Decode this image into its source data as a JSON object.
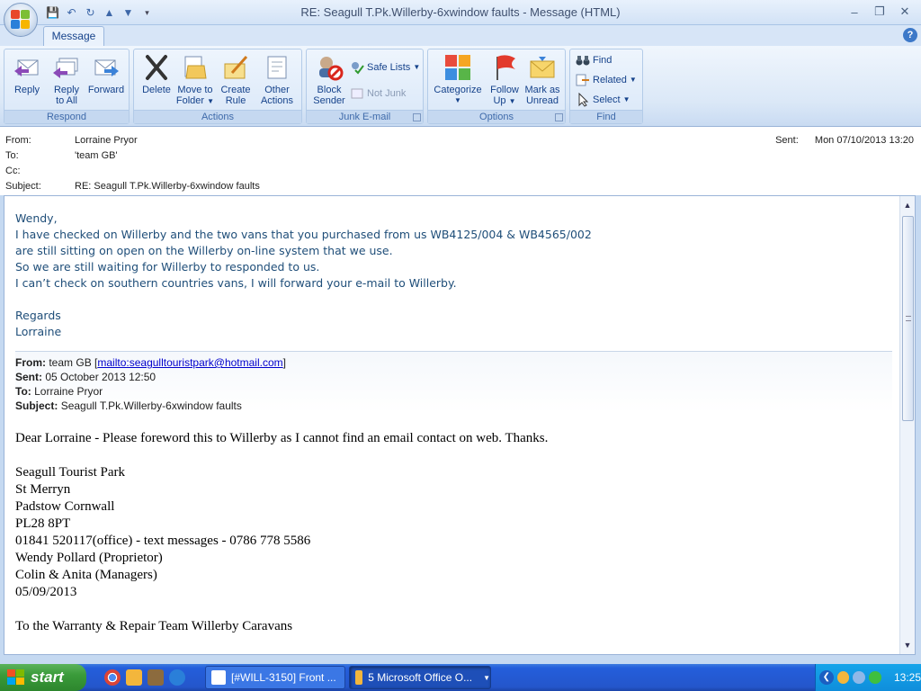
{
  "window": {
    "title": "RE: Seagull T.Pk.Willerby-6xwindow faults - Message (HTML)",
    "tab": "Message",
    "help": "?"
  },
  "ribbon": {
    "respond": {
      "label": "Respond",
      "reply": "Reply",
      "reply_all_1": "Reply",
      "reply_all_2": "to All",
      "forward": "Forward"
    },
    "actions": {
      "label": "Actions",
      "delete": "Delete",
      "move_1": "Move to",
      "move_2": "Folder",
      "create_1": "Create",
      "create_2": "Rule",
      "other_1": "Other",
      "other_2": "Actions"
    },
    "junk": {
      "label": "Junk E-mail",
      "block_1": "Block",
      "block_2": "Sender",
      "safe_lists": "Safe Lists",
      "not_junk": "Not Junk"
    },
    "options": {
      "label": "Options",
      "categorize": "Categorize",
      "follow_1": "Follow",
      "follow_2": "Up",
      "mark_1": "Mark as",
      "mark_2": "Unread"
    },
    "find": {
      "label": "Find",
      "find": "Find",
      "related": "Related",
      "select": "Select"
    }
  },
  "header": {
    "from_label": "From:",
    "from": "Lorraine Pryor",
    "to_label": "To:",
    "to": "'team GB'",
    "cc_label": "Cc:",
    "cc": "",
    "subject_label": "Subject:",
    "subject": "RE: Seagull T.Pk.Willerby-6xwindow faults",
    "sent_label": "Sent:",
    "sent": "Mon 07/10/2013 13:20"
  },
  "reply_lines": [
    "Wendy,",
    "I have checked on Willerby and the two vans that you purchased from us WB4125/004 & WB4565/002",
    "are still sitting on open on the Willerby on-line system that we use.",
    "So we are still waiting for Willerby to responded to us.",
    "I can’t check on southern countries vans, I will forward your e-mail to Willerby.",
    "",
    "Regards",
    "Lorraine"
  ],
  "quoted": {
    "from_label": "From:",
    "from_name": "team GB [",
    "from_link": "mailto:seagulltouristpark@hotmail.com",
    "from_end": "]",
    "sent_label": "Sent:",
    "sent": "05 October 2013 12:50",
    "to_label": "To:",
    "to": "Lorraine Pryor",
    "subject_label": "Subject:",
    "subject": "Seagull T.Pk.Willerby-6xwindow faults"
  },
  "quoted_body": [
    "Dear Lorraine - Please foreword this to Willerby as I cannot find an email contact on web. Thanks.",
    "",
    "Seagull Tourist Park",
    "St Merryn",
    "Padstow Cornwall",
    "PL28 8PT",
    "01841 520117(office) - text messages - 0786 778 5586",
    "Wendy Pollard (Proprietor)",
    "Colin & Anita (Managers)",
    "05/09/2013",
    "",
    "To the Warranty & Repair Team Willerby Caravans"
  ],
  "taskbar": {
    "start": "start",
    "task1": "[#WILL-3150] Front ...",
    "task2": "5 Microsoft Office O...",
    "clock": "13:25"
  }
}
